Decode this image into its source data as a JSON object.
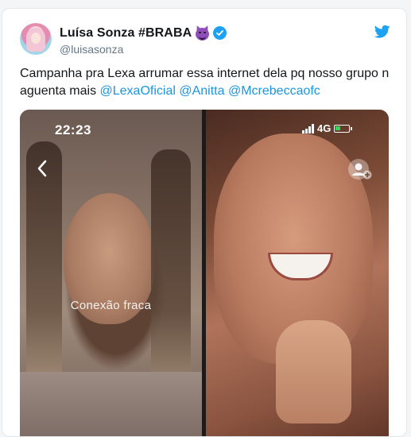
{
  "tweet": {
    "display_name": "Luísa Sonza #BRABA",
    "handle": "@luisasonza",
    "text": "Campanha pra Lexa arrumar essa internet dela pq nosso grupo n aguenta mais ",
    "mentions": [
      "@LexaOficial",
      "@Anitta",
      "@Mcrebeccaofc"
    ],
    "icons": [
      "devil-emoji-icon",
      "verified-icon",
      "twitter-bird-icon"
    ]
  },
  "media": {
    "time": "22:23",
    "connection_label": "Conexão fraca",
    "network": "4G",
    "icons": [
      "back-chevron-icon",
      "signal-icon",
      "battery-icon",
      "add-person-icon"
    ]
  },
  "colors": {
    "link": "#1b95e0",
    "twitter_blue": "#1da1f2",
    "text": "#14171a",
    "muted": "#657786"
  }
}
